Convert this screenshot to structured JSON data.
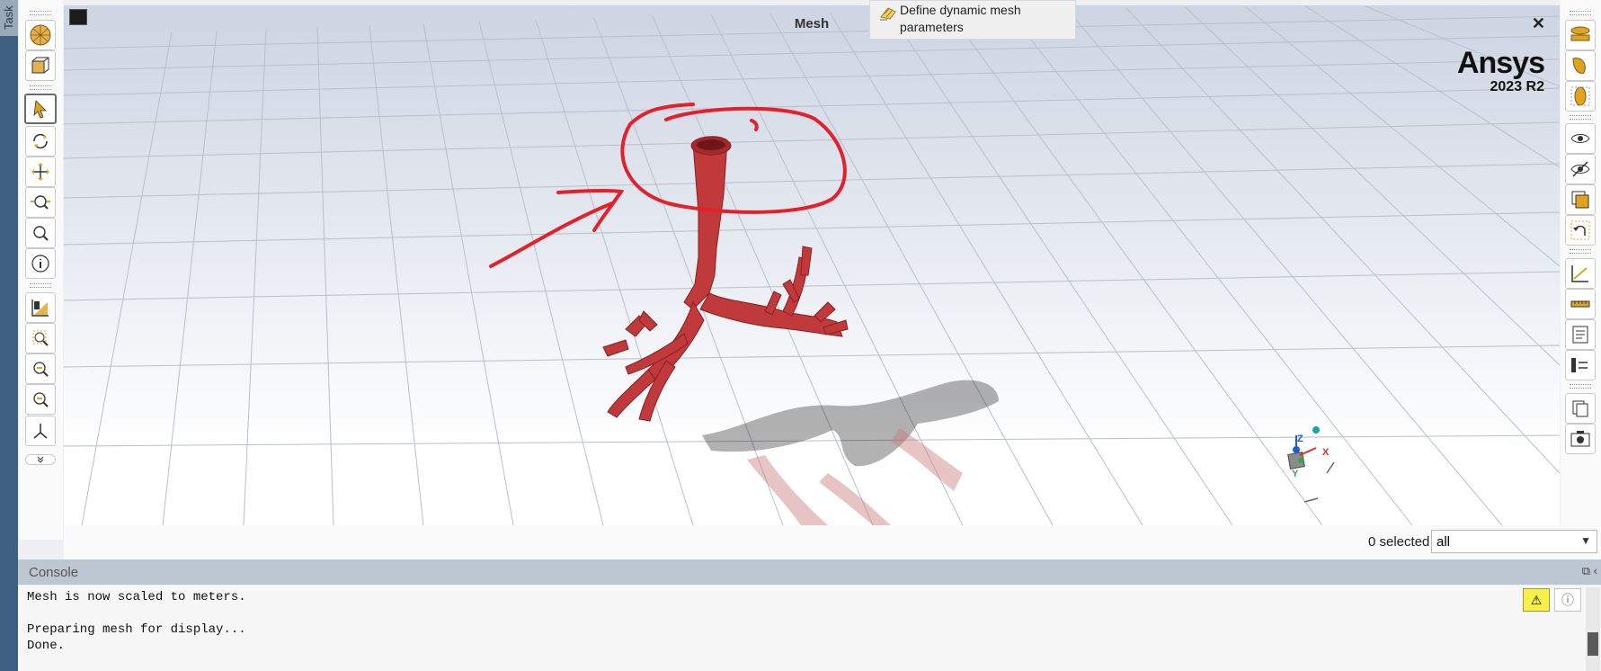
{
  "task_panel": {
    "label": "Task"
  },
  "viewport": {
    "title": "Mesh",
    "close_glyph": "✕",
    "brand_name": "Ansys",
    "brand_version": "2023 R2"
  },
  "tooltip": {
    "text": "Define dynamic mesh parameters",
    "icon": "dynamic-mesh-icon"
  },
  "left_toolbar": {
    "buttons": [
      "mesh-sphere-icon",
      "mesh-cube-icon",
      "select-arrow-icon",
      "rotate-icon",
      "pan-icon",
      "zoom-icon",
      "zoom-fit-icon",
      "info-icon",
      "clipping-icon",
      "zoom-box-icon",
      "zoom-in-icon",
      "zoom-out-icon",
      "axes-icon",
      "slider-icon"
    ]
  },
  "right_toolbar": {
    "buttons": [
      "view-front-icon",
      "view-side-icon",
      "view-iso-icon",
      "show-icon",
      "hide-icon",
      "overlay-icon",
      "undo-view-icon",
      "axes-plot-icon",
      "ruler-icon",
      "notes-icon",
      "legend-icon",
      "copy-icon",
      "screenshot-icon"
    ]
  },
  "selection": {
    "count_text": "0 selected",
    "filter_value": "all"
  },
  "console": {
    "title": "Console",
    "lines": [
      "Mesh is now scaled to meters.",
      "",
      "Preparing mesh for display...",
      "Done."
    ]
  },
  "colors": {
    "mesh": "#c0393b",
    "annotation": "#e3202b",
    "accent": "#e0a31e"
  }
}
